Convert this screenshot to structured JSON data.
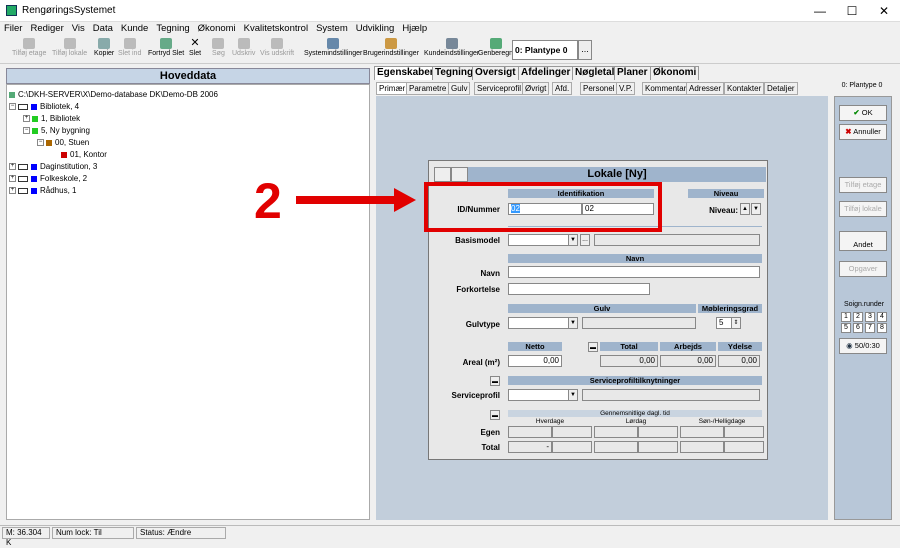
{
  "window": {
    "title": "RengøringsSystemet",
    "min": "—",
    "max": "☐",
    "close": "✕"
  },
  "menu": [
    "Filer",
    "Rediger",
    "Vis",
    "Data",
    "Kunde",
    "Tegning",
    "Økonomi",
    "Kvalitetskontrol",
    "System",
    "Udvikling",
    "Hjælp"
  ],
  "toolbar": {
    "buttons": [
      "Tilføj etage",
      "Tilføj lokale",
      "Kopier",
      "Slet ind",
      "Fortryd Slet",
      "Slet",
      "Søg",
      "Udskriv",
      "Vis udskrift",
      "Systemindstillinger",
      "Brugerindstillinger",
      "Kundeindstillinger",
      "Genberegn"
    ],
    "plant_type": "0: Plantype 0",
    "plant_btn": "..."
  },
  "left": {
    "header": "Hoveddata",
    "tree": [
      "C:\\DKH-SERVER\\X\\Demo-database DK\\Demo-DB 2006",
      "Bibliotek, 4",
      "1, Bibliotek",
      "5, Ny bygning",
      "00, Stuen",
      "01, Kontor",
      "Daginstitution, 3",
      "Folkeskole, 2",
      "Rådhus, 1"
    ]
  },
  "tabs_main": [
    "Egenskaber",
    "Tegning",
    "Oversigt",
    "Afdelinger",
    "Nøgletal",
    "Planer",
    "Økonomi"
  ],
  "tabs_sub": [
    "Primær",
    "Parametre",
    "Gulv",
    "Serviceprofil",
    "Øvrigt",
    "Afd.",
    "Personel",
    "V.P.",
    "Kommentar",
    "Adresser",
    "Kontakter",
    "Detaljer"
  ],
  "right": {
    "header": "0: Plantype 0",
    "ok": "OK",
    "cancel": "Annuller",
    "add_floor": "Tilføj etage",
    "add_room": "Tilføj lokale",
    "other": "Andet",
    "load": "Opgaver",
    "cleaning_rounds": "Soign.runder",
    "days": [
      "1",
      "2",
      "3",
      "4",
      "5",
      "6",
      "7",
      "8"
    ],
    "rounds_value": "50/0:30"
  },
  "form": {
    "title": "Lokale [Ny]",
    "identification": "Identifikation",
    "level": "Niveau",
    "id_label": "ID/Nummer",
    "id_value": "02",
    "nummer_value": "02",
    "level_label": "Niveau:",
    "basismodel": "Basismodel",
    "basis_btn": "...",
    "name_section": "Navn",
    "name_label": "Navn",
    "abbrev_label": "Forkortelse",
    "floor_section": "Gulv",
    "furnish_section": "Møbleringsgrad",
    "floortype_label": "Gulvtype",
    "furnish_value": "5",
    "netto": "Netto",
    "total": "Total",
    "arbejds": "Arbejds",
    "ydelse": "Ydelse",
    "area_label": "Areal (m²)",
    "netto_value": "0,00",
    "total_value": "0,00",
    "arbejds_value": "0,00",
    "ydelse_value": "0,00",
    "service_section": "Serviceprofiltilknytninger",
    "service_label": "Serviceprofil",
    "avg_time": "Gennemsnitlige dagl. tid",
    "hverdage": "Hverdage",
    "loerdage": "Lørdag",
    "soen": "Søn-/Helligdage",
    "egen": "Egen",
    "total_row": "Total",
    "dash": "-"
  },
  "annotation": {
    "number": "2"
  },
  "status": {
    "memory": "M: 36.304 K",
    "numlock": "Num lock: Til",
    "status": "Status: Ændre"
  },
  "colors": {
    "accent": "#9fb4cc",
    "annotation": "#e10000"
  }
}
